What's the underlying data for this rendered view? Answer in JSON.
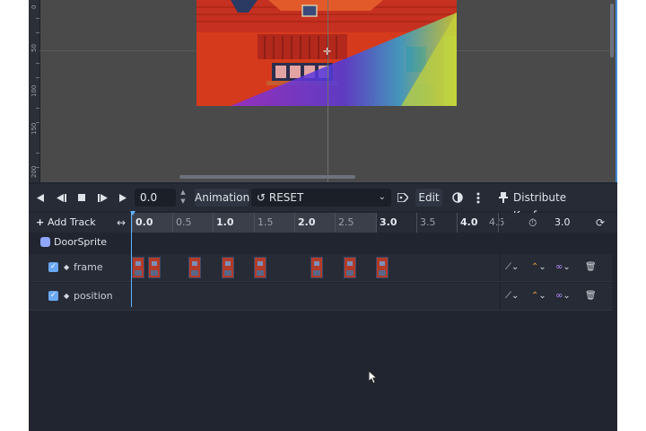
{
  "viewport": {
    "ruler_ticks": [
      "0",
      "50",
      "100",
      "150",
      "200"
    ],
    "crosshair_icon": "crosshair-icon"
  },
  "toolbar": {
    "time_value": "0.0",
    "animation_label": "Animation",
    "reset_label": "RESET",
    "edit_label": "Edit",
    "distribute_label": "Distribute Keyframes",
    "icons": [
      "play-backwards-icon",
      "play-backwards-from-end-icon",
      "stop-icon",
      "play-from-start-icon",
      "play-icon",
      "spin-icon",
      "reset-icon",
      "chevron-down-icon",
      "edit-icon",
      "onion-skin-icon",
      "more-icon",
      "pin-icon"
    ]
  },
  "timeline": {
    "add_track_label": "Add Track",
    "ruler_labels": [
      "0.0",
      "0.5",
      "1.0",
      "1.5",
      "2.0",
      "2.5",
      "3.0",
      "3.5",
      "4.0",
      "4.5"
    ],
    "animation_length": "3.0",
    "node_name": "DoorSprite",
    "tracks": [
      {
        "name": "frame",
        "enabled": true
      },
      {
        "name": "position",
        "enabled": true
      }
    ],
    "frame_keyframe_times": [
      0.0,
      0.2,
      0.7,
      1.1,
      1.5,
      2.2,
      2.6,
      3.0
    ],
    "colors": {
      "accent": "#5fb2ff",
      "panel": "#202531",
      "viewport": "#4a4a4a",
      "interp_curve": "#d6d9de",
      "update_mode": "#f2a23c",
      "loop_mode": "#b98cff"
    }
  }
}
